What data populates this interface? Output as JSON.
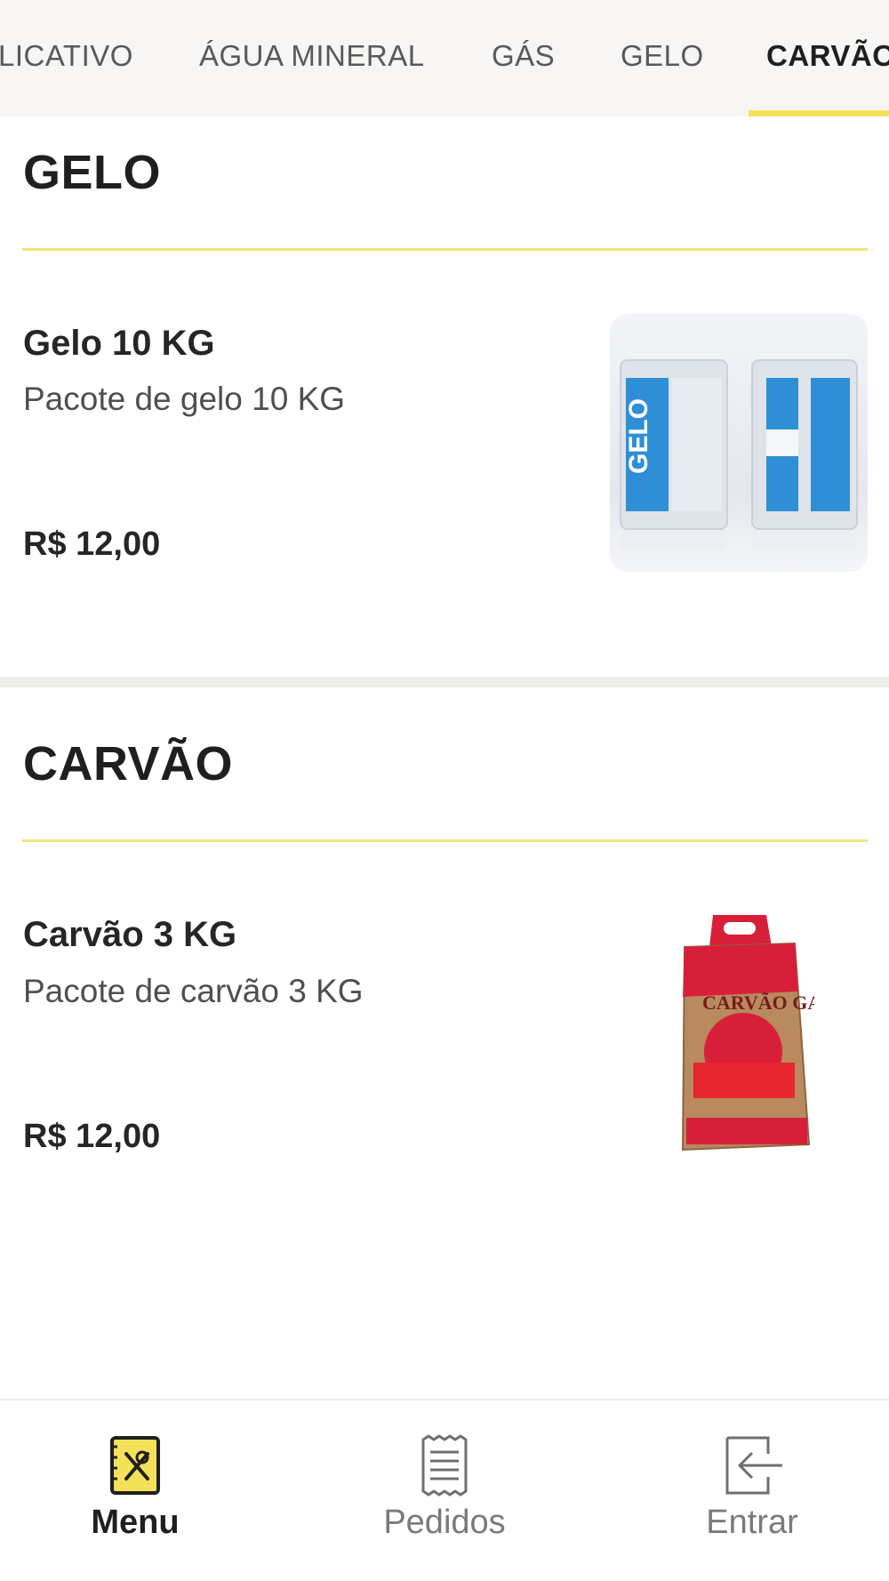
{
  "tabs": [
    {
      "label": "LICATIVO",
      "active": false
    },
    {
      "label": "ÁGUA MINERAL",
      "active": false
    },
    {
      "label": "GÁS",
      "active": false
    },
    {
      "label": "GELO",
      "active": false
    },
    {
      "label": "CARVÃO",
      "active": true
    }
  ],
  "sections": [
    {
      "title": "GELO",
      "products": [
        {
          "name": "Gelo 10 KG",
          "description": "Pacote de gelo 10 KG",
          "price": "R$ 12,00",
          "image_text": "GELO"
        }
      ]
    },
    {
      "title": "CARVÃO",
      "products": [
        {
          "name": "Carvão 3 KG",
          "description": "Pacote de carvão 3 KG",
          "price": "R$ 12,00",
          "image_text": "CARVÃO GARCIA"
        }
      ]
    }
  ],
  "bottom_nav": [
    {
      "label": "Menu",
      "icon": "menu-book-icon",
      "active": true
    },
    {
      "label": "Pedidos",
      "icon": "receipt-icon",
      "active": false
    },
    {
      "label": "Entrar",
      "icon": "login-icon",
      "active": false
    }
  ],
  "colors": {
    "accent": "#f4e15a",
    "tabbar_bg": "#f7f6f4",
    "text_dark": "#1f1f1f",
    "text_muted": "#7a7a7a"
  }
}
